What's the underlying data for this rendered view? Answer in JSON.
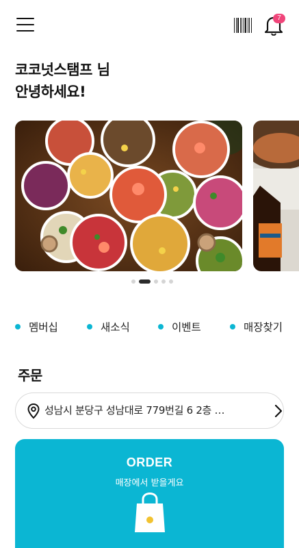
{
  "header": {
    "menu_icon": "hamburger-menu-icon",
    "barcode_icon": "barcode-icon",
    "bell_icon": "bell-icon",
    "notification_count": "7",
    "badge_color": "#f0457a"
  },
  "greeting": {
    "line1": "코코넛스탬프 님",
    "line2": "안녕하세요!"
  },
  "banner": {
    "slide_count": 5,
    "active_index": 1
  },
  "quick_links": [
    {
      "label": "멤버십"
    },
    {
      "label": "새소식"
    },
    {
      "label": "이벤트"
    },
    {
      "label": "매장찾기"
    }
  ],
  "order_section": {
    "title": "주문",
    "address": "성남시 분당구 성남대로 779번길 6 2층 …",
    "order_label": "ORDER",
    "order_sub": "매장에서 받을게요",
    "accent_color": "#0bb6d3"
  }
}
